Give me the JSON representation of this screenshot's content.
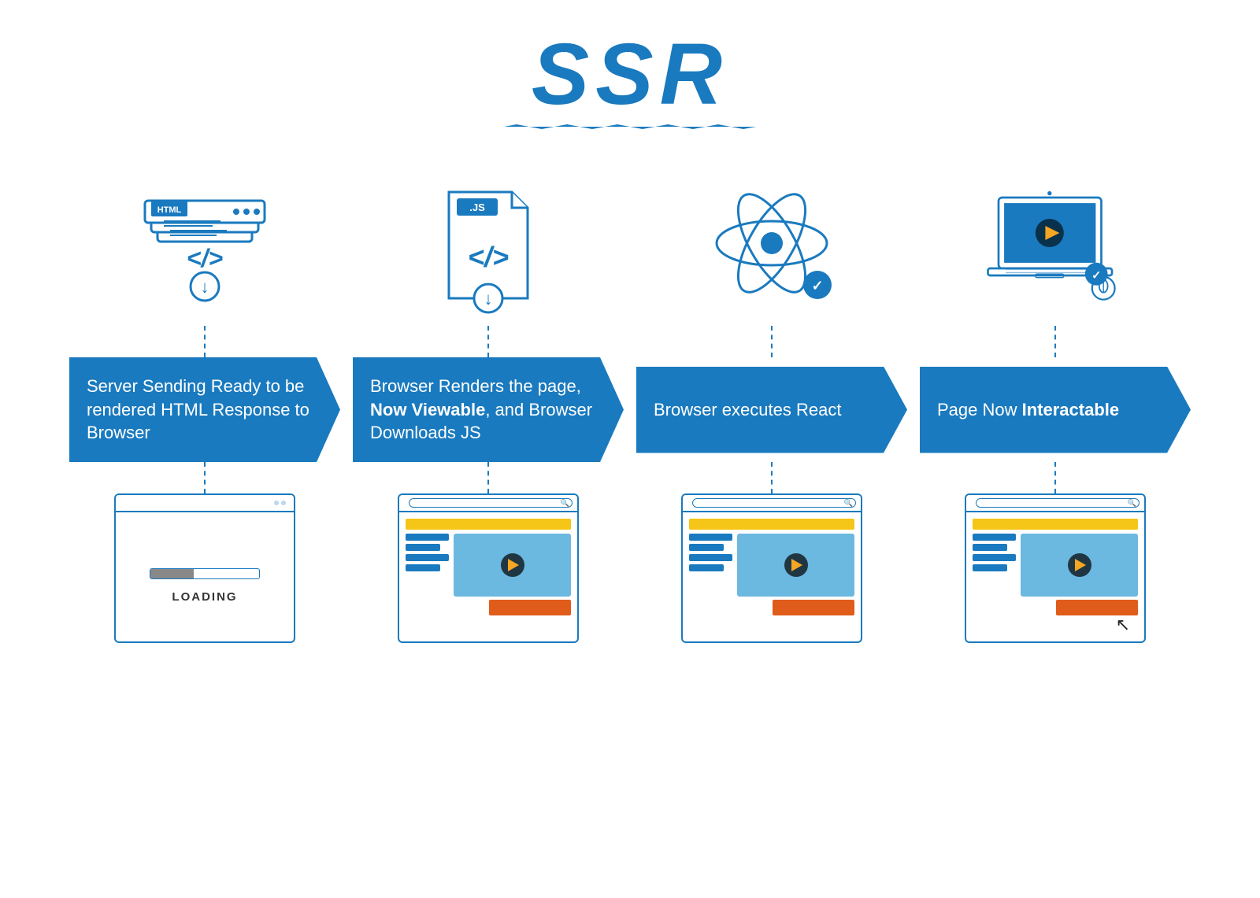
{
  "title": "SSR",
  "icons": [
    {
      "id": "html-server",
      "label": "HTML server stack"
    },
    {
      "id": "js-file",
      "label": "JS file"
    },
    {
      "id": "react-atom",
      "label": "React atom"
    },
    {
      "id": "laptop-video",
      "label": "Laptop with video"
    }
  ],
  "arrows": [
    {
      "text_plain": "Server Sending Ready to be rendered HTML Response to Browser",
      "text_html": "Server Sending Ready to be rendered HTML Response to Browser"
    },
    {
      "text_plain": "Browser Renders the page, Now Viewable, and Browser Downloads JS",
      "text_html": "Browser Renders the page, <b>Now Viewable</b>, and Browser Downloads JS",
      "bold_part": "Now Viewable"
    },
    {
      "text_plain": "Browser executes React",
      "text_html": "Browser executes React"
    },
    {
      "text_plain": "Page Now Interactable",
      "text_html": "Page Now <b>Interactable</b>",
      "bold_part": "Interactable"
    }
  ],
  "screens": [
    {
      "type": "loading",
      "label": "LOADING"
    },
    {
      "type": "content",
      "label": "content-viewable"
    },
    {
      "type": "content",
      "label": "content-react"
    },
    {
      "type": "content-interactive",
      "label": "content-interactive"
    }
  ],
  "colors": {
    "blue": "#1a7abf",
    "yellow": "#f5c518",
    "orange": "#e05c1a",
    "dark": "#222222"
  }
}
